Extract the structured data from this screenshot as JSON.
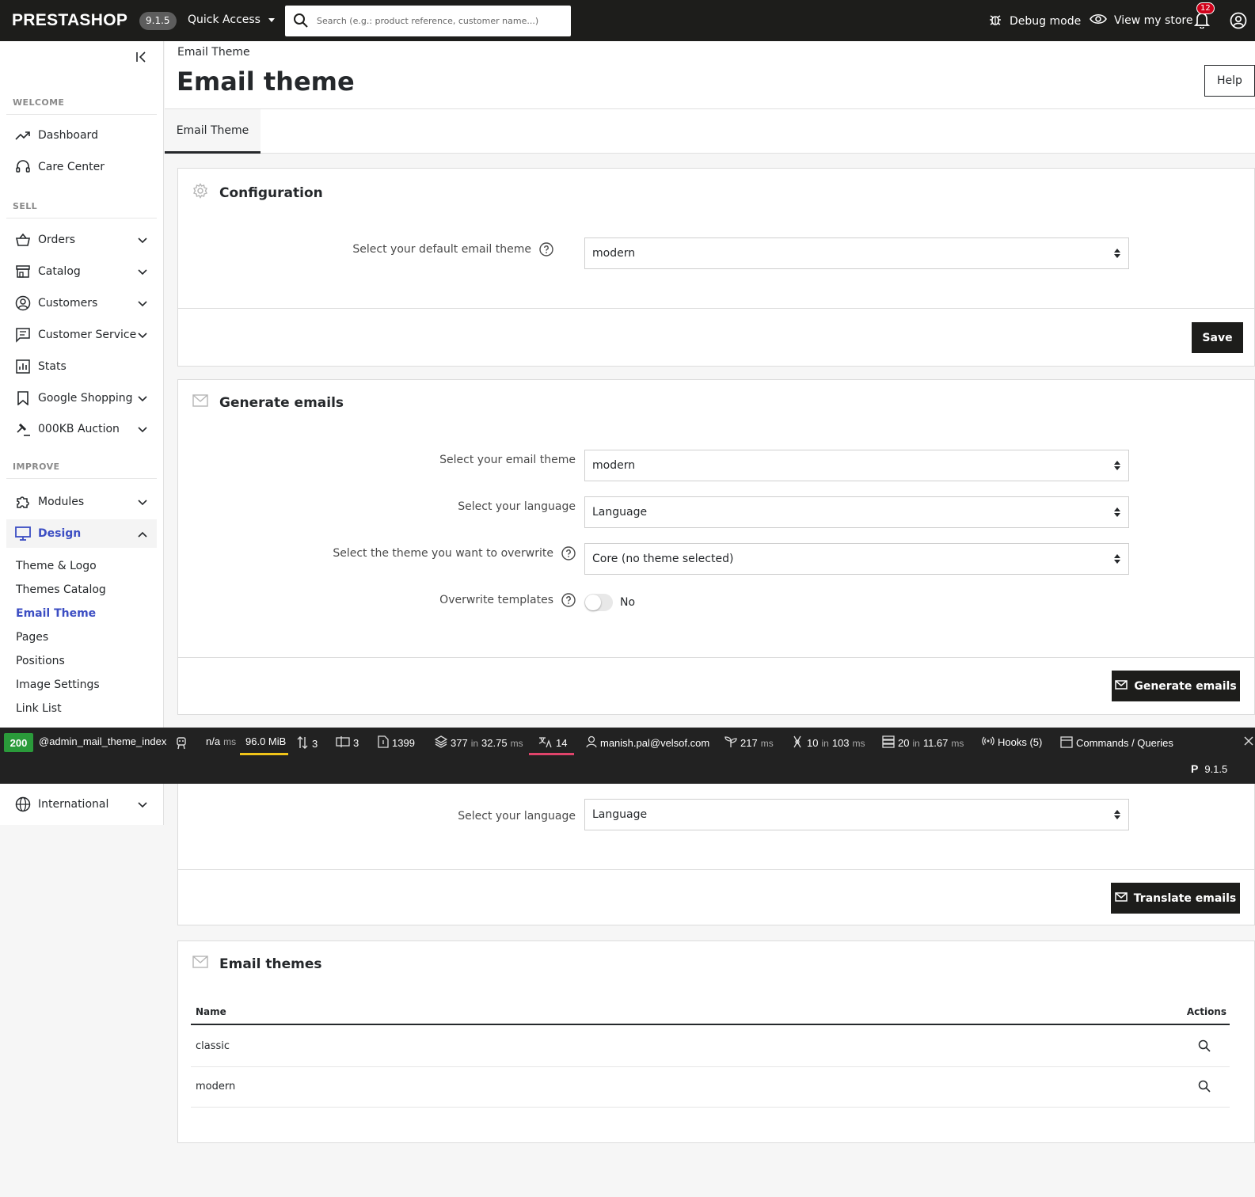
{
  "header": {
    "logo": "PRESTASHOP",
    "version": "9.1.5",
    "quick_access": "Quick Access",
    "search_placeholder": "Search (e.g.: product reference, customer name...)",
    "debug_mode": "Debug mode",
    "view_store": "View my store",
    "notifications_count": "12"
  },
  "sidebar": {
    "sections": {
      "welcome": "WELCOME",
      "sell": "SELL",
      "improve": "IMPROVE"
    },
    "items": {
      "dashboard": "Dashboard",
      "care_center": "Care Center",
      "orders": "Orders",
      "catalog": "Catalog",
      "customers": "Customers",
      "customer_service": "Customer Service",
      "stats": "Stats",
      "google_shopping": "Google Shopping",
      "auction": "000KB Auction",
      "modules": "Modules",
      "design": "Design",
      "international": "International"
    },
    "design_submenu": [
      "Theme & Logo",
      "Themes Catalog",
      "Email Theme",
      "Pages",
      "Positions",
      "Image Settings",
      "Link List"
    ]
  },
  "page": {
    "breadcrumb": "Email Theme",
    "title": "Email theme",
    "help": "Help",
    "tab": "Email Theme"
  },
  "configuration": {
    "title": "Configuration",
    "default_theme_label": "Select your default email theme",
    "default_theme_value": "modern",
    "save": "Save"
  },
  "generate": {
    "title": "Generate emails",
    "theme_label": "Select your email theme",
    "theme_value": "modern",
    "language_label": "Select your language",
    "language_value": "Language",
    "overwrite_theme_label": "Select the theme you want to overwrite",
    "overwrite_theme_value": "Core (no theme selected)",
    "overwrite_templates_label": "Overwrite templates",
    "overwrite_templates_value": "No",
    "button": "Generate emails"
  },
  "translate": {
    "language_label": "Select your language",
    "language_value": "Language",
    "button": "Translate emails"
  },
  "themes_table": {
    "title": "Email themes",
    "col_name": "Name",
    "col_actions": "Actions",
    "rows": [
      "classic",
      "modern"
    ]
  },
  "debug": {
    "status": "200",
    "route": "@admin_mail_theme_index",
    "time_value": "n/a",
    "time_unit": "ms",
    "memory": "96.0 MiB",
    "requests": "3",
    "forms": "3",
    "documents": "1399",
    "cache_count": "377",
    "cache_in": "in",
    "cache_time": "32.75",
    "cache_unit": "ms",
    "translations": "14",
    "user": "manish.pal@velsof.com",
    "render_time": "217",
    "render_unit": "ms",
    "events": "10",
    "events_in": "in",
    "events_time": "103",
    "events_unit": "ms",
    "db_queries": "20",
    "db_in": "in",
    "db_time": "11.67",
    "db_unit": "ms",
    "hooks": "Hooks (5)",
    "commands": "Commands / Queries",
    "version": "9.1.5",
    "memory_color": "#f0c419",
    "translations_color": "#e0446b"
  }
}
